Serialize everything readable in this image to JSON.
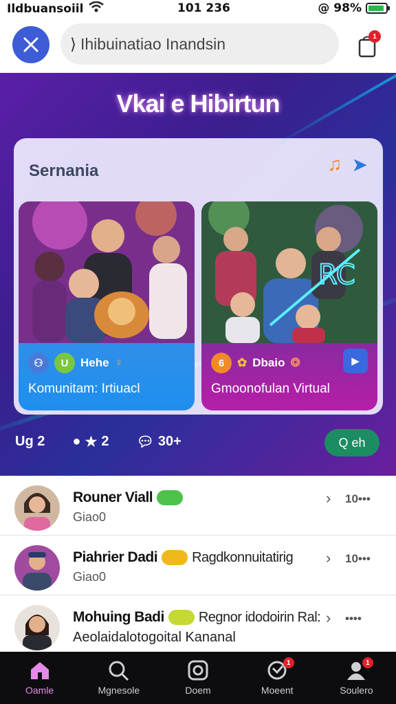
{
  "status_bar": {
    "carrier": "Ildbuansoiil",
    "time": "101 236",
    "battery_text": "@ 98%",
    "battery_level": 0.9
  },
  "header": {
    "search_text": "Ihibuinatiao Inandsin",
    "notification_badge": "1"
  },
  "hero": {
    "title": "Vkai e Hibirtun",
    "panel_title": "Sernania",
    "cards": [
      {
        "caption": "Komunitam: Irtiuacl",
        "tag_text": "Hehe"
      },
      {
        "caption": "Gmoonofulan Virtual",
        "tag_text": "Dbaio"
      }
    ],
    "stats": [
      {
        "label": "Ug 2"
      },
      {
        "label": "2"
      },
      {
        "label": "30+"
      }
    ],
    "join_label": "Q eh"
  },
  "list": [
    {
      "name": "Rouner Viall",
      "extra": "",
      "sub": "Giao0",
      "count": "10•••",
      "pill_color": "#4cc24a"
    },
    {
      "name": "Piahrier Dadi",
      "extra": "Ragdkonnuitatirig",
      "sub": "Giao0",
      "count": "10•••",
      "pill_color": "#f0b81a"
    },
    {
      "name": "Mohuing Badi",
      "extra": "Regnor idodoirin Ral:",
      "sub": "Aeolaidalotogoital Kananal",
      "count": "••••",
      "pill_color": "#c6d834"
    }
  ],
  "bottom_nav": [
    {
      "label": "Oamle",
      "icon": "home-icon",
      "active": true
    },
    {
      "label": "Mgnesole",
      "icon": "search-icon",
      "active": false
    },
    {
      "label": "Doem",
      "icon": "instagram-icon",
      "active": false
    },
    {
      "label": "Moeent",
      "icon": "game-icon",
      "active": false,
      "badge": "1"
    },
    {
      "label": "Soulero",
      "icon": "profile-icon",
      "active": false,
      "badge": "1"
    }
  ],
  "colors": {
    "accent": "#3d5cd6",
    "join": "#1c8c63",
    "nav_active": "#e58ae8"
  }
}
